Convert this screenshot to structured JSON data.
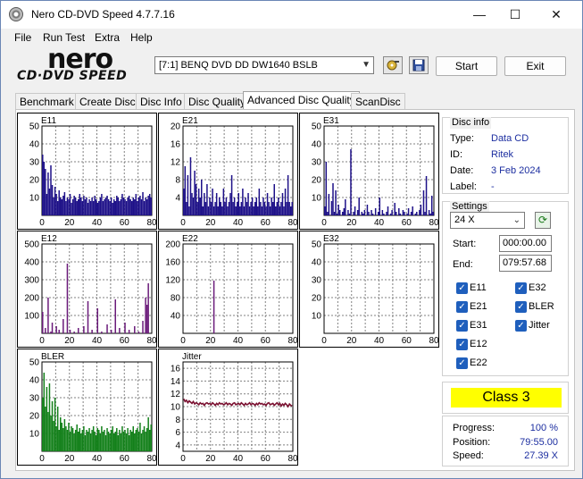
{
  "window": {
    "title": "Nero CD-DVD Speed 4.7.7.16"
  },
  "window_controls": {
    "minimize": "—",
    "maximize": "☐",
    "close": "✕"
  },
  "menu": [
    "File",
    "Run Test",
    "Extra",
    "Help"
  ],
  "logo": {
    "line1": "nero",
    "line2": "CD·DVD SPEED"
  },
  "toolbar": {
    "drive": "[7:1]  BENQ DVD DD DW1640 BSLB",
    "start_label": "Start",
    "exit_label": "Exit"
  },
  "tabs": [
    "Benchmark",
    "Create Disc",
    "Disc Info",
    "Disc Quality",
    "Advanced Disc Quality",
    "ScanDisc"
  ],
  "active_tab": "Advanced Disc Quality",
  "chart_data": [
    {
      "type": "bar",
      "title": "E11",
      "x_ticks": [
        "0",
        "20",
        "40",
        "60",
        "80"
      ],
      "y_ticks": [
        "50",
        "40",
        "30",
        "20",
        "10"
      ],
      "ylim": [
        0,
        50
      ],
      "xlim": [
        0,
        80
      ],
      "color": "#1d1088",
      "values_profile": [
        34,
        30,
        26,
        12,
        24,
        15,
        28,
        17,
        10,
        16,
        12,
        8,
        14,
        10,
        9,
        11,
        13,
        8,
        10,
        9,
        12,
        7,
        9,
        11,
        10,
        8,
        9,
        12,
        10,
        8,
        11,
        9,
        10,
        7,
        9,
        8,
        10,
        8,
        11,
        9,
        7,
        8,
        10,
        12,
        8,
        9,
        10,
        11,
        9,
        8,
        10,
        7,
        9,
        8,
        11,
        10,
        8,
        9,
        12,
        10,
        9,
        8,
        10,
        11,
        9,
        8,
        10,
        9,
        12,
        8,
        10,
        11,
        9,
        13,
        8,
        10,
        9,
        11,
        12,
        10
      ]
    },
    {
      "type": "bar",
      "title": "E21",
      "x_ticks": [
        "0",
        "20",
        "40",
        "60",
        "80"
      ],
      "y_ticks": [
        "20",
        "16",
        "12",
        "8",
        "4"
      ],
      "ylim": [
        0,
        20
      ],
      "xlim": [
        0,
        80
      ],
      "color": "#1d1088",
      "values_profile": [
        6,
        11,
        3,
        9,
        2,
        13,
        5,
        4,
        10,
        7,
        3,
        6,
        4,
        8,
        2,
        5,
        3,
        7,
        2,
        4,
        3,
        6,
        2,
        3,
        5,
        2,
        4,
        3,
        2,
        6,
        3,
        4,
        2,
        3,
        5,
        9,
        3,
        4,
        2,
        3,
        5,
        2,
        3,
        6,
        2,
        4,
        3,
        5,
        2,
        3,
        4,
        2,
        3,
        4,
        2,
        6,
        3,
        2,
        4,
        3,
        2,
        5,
        3,
        2,
        4,
        3,
        7,
        2,
        3,
        4,
        2,
        3,
        5,
        2,
        6,
        3,
        9,
        3,
        2,
        3
      ]
    },
    {
      "type": "bar",
      "title": "E31",
      "x_ticks": [
        "0",
        "20",
        "40",
        "60",
        "80"
      ],
      "y_ticks": [
        "50",
        "40",
        "30",
        "20",
        "10"
      ],
      "ylim": [
        0,
        50
      ],
      "xlim": [
        0,
        80
      ],
      "color": "#1d1088",
      "values_profile": [
        5,
        30,
        2,
        12,
        0,
        8,
        18,
        2,
        14,
        1,
        6,
        3,
        0,
        2,
        4,
        9,
        0,
        3,
        1,
        37,
        0,
        2,
        5,
        0,
        3,
        10,
        0,
        2,
        1,
        3,
        0,
        6,
        2,
        0,
        3,
        1,
        0,
        4,
        0,
        2,
        10,
        0,
        3,
        1,
        0,
        2,
        5,
        0,
        1,
        3,
        0,
        7,
        2,
        0,
        4,
        1,
        0,
        3,
        2,
        0,
        1,
        4,
        0,
        2,
        5,
        0,
        1,
        2,
        0,
        3,
        6,
        0,
        14,
        2,
        22,
        0,
        3,
        1,
        11,
        2
      ]
    },
    {
      "type": "bar",
      "title": "E12",
      "x_ticks": [
        "0",
        "20",
        "40",
        "60",
        "80"
      ],
      "y_ticks": [
        "500",
        "400",
        "300",
        "200",
        "100"
      ],
      "ylim": [
        0,
        500
      ],
      "xlim": [
        0,
        80
      ],
      "color": "#6a1a7a",
      "values_profile": [
        120,
        0,
        30,
        0,
        200,
        0,
        10,
        60,
        0,
        0,
        40,
        0,
        20,
        0,
        0,
        80,
        0,
        0,
        390,
        0,
        20,
        0,
        0,
        10,
        0,
        0,
        30,
        0,
        0,
        0,
        40,
        0,
        0,
        180,
        0,
        0,
        20,
        0,
        0,
        0,
        140,
        0,
        0,
        10,
        0,
        0,
        0,
        50,
        0,
        0,
        20,
        0,
        0,
        190,
        0,
        0,
        30,
        0,
        0,
        0,
        60,
        0,
        0,
        20,
        0,
        0,
        0,
        40,
        0,
        0,
        10,
        0,
        0,
        70,
        0,
        200,
        160,
        280,
        0,
        0
      ]
    },
    {
      "type": "bar",
      "title": "E22",
      "x_ticks": [
        "0",
        "20",
        "40",
        "60",
        "80"
      ],
      "y_ticks": [
        "200",
        "160",
        "120",
        "80",
        "40"
      ],
      "ylim": [
        0,
        200
      ],
      "xlim": [
        0,
        80
      ],
      "color": "#6a1a7a",
      "values_profile": [
        0,
        0,
        0,
        0,
        0,
        0,
        0,
        0,
        0,
        0,
        0,
        0,
        0,
        0,
        0,
        0,
        0,
        0,
        0,
        0,
        0,
        0,
        118,
        0,
        0,
        0,
        0,
        0,
        0,
        0,
        0,
        0,
        0,
        0,
        0,
        0,
        0,
        0,
        0,
        0,
        0,
        0,
        0,
        0,
        0,
        0,
        0,
        0,
        0,
        0,
        0,
        0,
        0,
        0,
        0,
        0,
        0,
        0,
        0,
        0,
        0,
        0,
        0,
        0,
        0,
        0,
        0,
        0,
        0,
        0,
        0,
        0,
        0,
        0,
        0,
        0,
        0,
        0,
        0,
        0
      ]
    },
    {
      "type": "bar",
      "title": "E32",
      "x_ticks": [
        "0",
        "20",
        "40",
        "60",
        "80"
      ],
      "y_ticks": [
        "50",
        "40",
        "30",
        "20",
        "10"
      ],
      "ylim": [
        0,
        50
      ],
      "xlim": [
        0,
        80
      ],
      "color": "#6a1a7a",
      "values_profile": []
    },
    {
      "type": "bar",
      "title": "BLER",
      "x_ticks": [
        "0",
        "20",
        "40",
        "60",
        "80"
      ],
      "y_ticks": [
        "50",
        "40",
        "30",
        "20",
        "10"
      ],
      "ylim": [
        0,
        50
      ],
      "xlim": [
        0,
        80
      ],
      "color": "#13801a",
      "values_profile": [
        30,
        44,
        25,
        36,
        22,
        38,
        20,
        28,
        17,
        30,
        14,
        25,
        12,
        19,
        16,
        13,
        18,
        14,
        12,
        16,
        11,
        14,
        13,
        10,
        12,
        15,
        11,
        13,
        10,
        12,
        14,
        9,
        12,
        11,
        13,
        10,
        12,
        14,
        11,
        9,
        13,
        12,
        10,
        14,
        11,
        12,
        9,
        13,
        11,
        10,
        12,
        14,
        10,
        11,
        13,
        9,
        12,
        10,
        14,
        11,
        12,
        10,
        13,
        9,
        12,
        11,
        14,
        10,
        12,
        13,
        11,
        16,
        10,
        12,
        14,
        11,
        13,
        19,
        12,
        15
      ]
    },
    {
      "type": "line",
      "title": "Jitter",
      "x_ticks": [
        "0",
        "20",
        "40",
        "60",
        "80"
      ],
      "y_ticks": [
        "16",
        "14",
        "12",
        "10",
        "8",
        "6",
        "4"
      ],
      "ylim": [
        3,
        17
      ],
      "xlim": [
        0,
        80
      ],
      "color": "#7a1030",
      "values_profile": [
        11.2,
        10.8,
        11.0,
        10.6,
        10.9,
        10.7,
        10.5,
        10.8,
        10.4,
        10.6,
        10.5,
        10.3,
        10.6,
        10.4,
        10.5,
        10.2,
        10.5,
        10.6,
        10.4,
        10.5,
        10.3,
        10.6,
        10.4,
        10.2,
        10.5,
        10.3,
        10.6,
        10.4,
        10.5,
        10.3,
        10.4,
        10.6,
        10.3,
        10.5,
        10.4,
        10.2,
        10.5,
        10.6,
        10.3,
        10.4,
        10.5,
        10.3,
        10.6,
        10.4,
        10.2,
        10.5,
        10.3,
        10.4,
        10.6,
        10.3,
        10.5,
        10.4,
        10.2,
        10.5,
        10.3,
        10.6,
        10.4,
        10.5,
        10.3,
        10.4,
        10.2,
        10.5,
        10.6,
        10.3,
        10.4,
        10.5,
        10.2,
        10.4,
        10.6,
        10.3,
        10.5,
        10.1,
        10.4,
        10.2,
        10.5,
        10.3,
        10.0,
        10.4,
        10.2,
        10.1
      ]
    }
  ],
  "disc_info": {
    "title": "Disc info",
    "rows": [
      {
        "label": "Type:",
        "value": "Data CD"
      },
      {
        "label": "ID:",
        "value": "Ritek"
      },
      {
        "label": "Date:",
        "value": "3 Feb 2024"
      },
      {
        "label": "Label:",
        "value": "-"
      }
    ]
  },
  "settings": {
    "title": "Settings",
    "speed": "24 X",
    "start_label": "Start:",
    "start_value": "000:00.00",
    "end_label": "End:",
    "end_value": "079:57.68",
    "checks_left": [
      "E11",
      "E21",
      "E31",
      "E12",
      "E22"
    ],
    "checks_right": [
      "E32",
      "BLER",
      "Jitter"
    ]
  },
  "quality_class": "Class 3",
  "progress": {
    "rows": [
      {
        "label": "Progress:",
        "value": "100 %"
      },
      {
        "label": "Position:",
        "value": "79:55.00"
      },
      {
        "label": "Speed:",
        "value": "27.39 X"
      }
    ]
  },
  "colors": {
    "bar_blue": "#1d1088",
    "bar_purple": "#6a1a7a",
    "bar_green": "#13801a",
    "jitter": "#7a1030",
    "class_badge": "#ffff00",
    "value_text": "#1c2ea0"
  }
}
